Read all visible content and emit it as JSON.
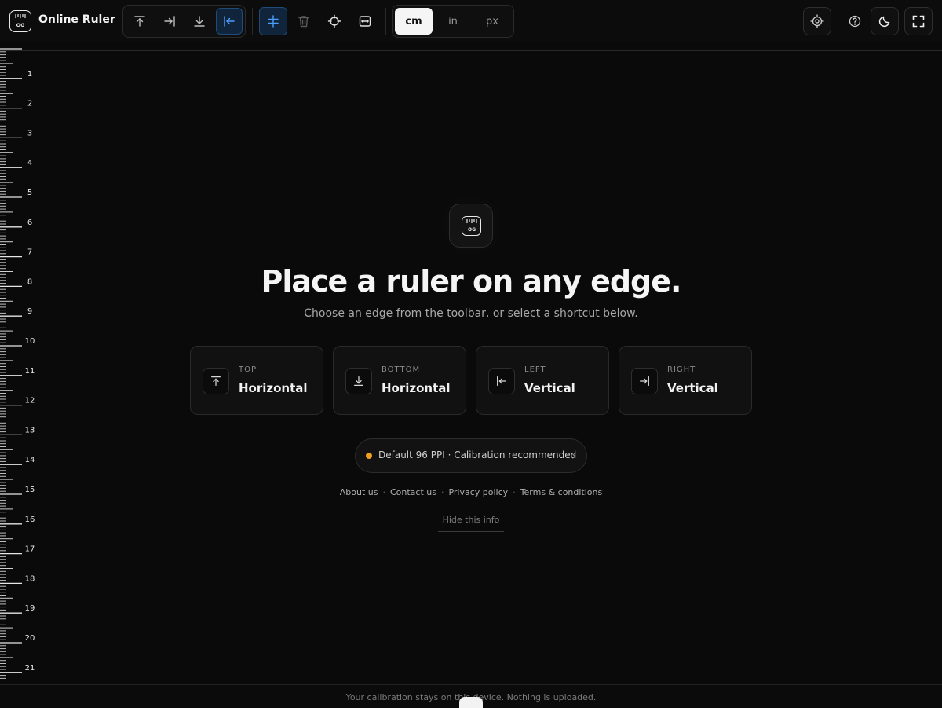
{
  "app": {
    "title": "Online Ruler",
    "logo_text": "OG"
  },
  "toolbar": {
    "edge_buttons": [
      {
        "icon": "align-top-icon",
        "state": "inactive"
      },
      {
        "icon": "align-right-icon",
        "state": "inactive"
      },
      {
        "icon": "align-bottom-icon",
        "state": "inactive"
      },
      {
        "icon": "align-left-icon",
        "state": "active"
      }
    ],
    "tool_buttons": [
      {
        "icon": "split-guide-icon",
        "state": "active"
      },
      {
        "icon": "trash-icon",
        "state": "disabled"
      },
      {
        "icon": "crosshair-icon",
        "state": "inactive"
      },
      {
        "icon": "swap-screen-icon",
        "state": "inactive"
      }
    ],
    "units": [
      "cm",
      "in",
      "px"
    ],
    "selected_unit": "cm",
    "right_buttons": [
      "calibrate-target-icon",
      "help-icon",
      "dark-mode-moon-icon",
      "fullscreen-icon"
    ]
  },
  "ruler": {
    "edge": "left",
    "unit": "cm",
    "labels": [
      "1",
      "2",
      "3",
      "4",
      "5",
      "6",
      "7",
      "8",
      "9",
      "10",
      "11",
      "12",
      "13",
      "14",
      "15",
      "16",
      "17",
      "18",
      "19",
      "20",
      "21"
    ]
  },
  "main": {
    "icon_text": "OG",
    "headline": "Place a ruler on any edge.",
    "subline": "Choose an edge from the toolbar, or select a shortcut below.",
    "cards": [
      {
        "kicker": "TOP",
        "title": "Horizontal",
        "icon": "align-top-icon"
      },
      {
        "kicker": "BOTTOM",
        "title": "Horizontal",
        "icon": "align-bottom-icon"
      },
      {
        "kicker": "LEFT",
        "title": "Vertical",
        "icon": "align-left-icon"
      },
      {
        "kicker": "RIGHT",
        "title": "Vertical",
        "icon": "align-right-icon"
      }
    ],
    "calibration": {
      "text": "Default 96 PPI · Calibration recommended",
      "status_color": "#f0a020"
    },
    "links": [
      "About us",
      "Contact us",
      "Privacy policy",
      "Terms & conditions"
    ],
    "hide_info": "Hide this info"
  },
  "footer": {
    "text": "Your calibration stays on this device. Nothing is uploaded."
  },
  "colors": {
    "accent_blue": "#4a9eff",
    "background": "#0a0a0a",
    "warning": "#f0a020"
  }
}
